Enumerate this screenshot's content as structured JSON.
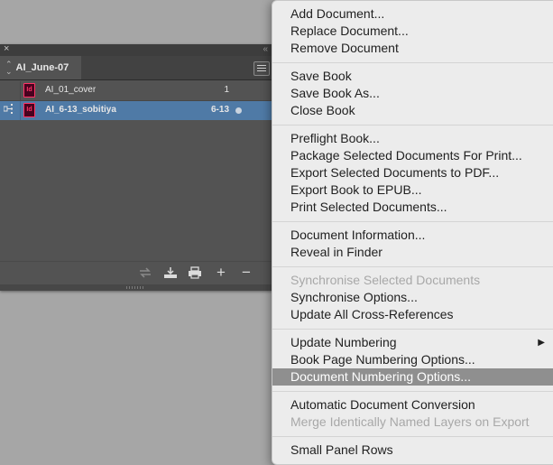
{
  "panel": {
    "tab_label": "AI_June-07",
    "documents": [
      {
        "name": "AI_01_cover",
        "pages": "1",
        "icon_text": "Id"
      },
      {
        "name": "AI_6-13_sobitiya",
        "pages": "6-13",
        "icon_text": "Id"
      }
    ],
    "footer_icons": [
      "sync-styles-icon",
      "add-document-icon",
      "print-icon",
      "plus-icon",
      "minus-icon"
    ],
    "glyphs": {
      "close": "×",
      "collapse": "«",
      "up": "⌃",
      "down": "⌄",
      "plus": "+",
      "minus": "−"
    }
  },
  "menu": {
    "groups": [
      [
        "Add Document...",
        "Replace Document...",
        "Remove Document"
      ],
      [
        "Save Book",
        "Save Book As...",
        "Close Book"
      ],
      [
        "Preflight Book...",
        "Package Selected Documents For Print...",
        "Export Selected Documents to PDF...",
        "Export Book to EPUB...",
        "Print Selected Documents..."
      ],
      [
        "Document Information...",
        "Reveal in Finder"
      ],
      [
        "Synchronise Selected Documents",
        "Synchronise Options...",
        "Update All Cross-References"
      ],
      [
        "Update Numbering",
        "Book Page Numbering Options...",
        "Document Numbering Options..."
      ],
      [
        "Automatic Document Conversion",
        "Merge Identically Named Layers on Export"
      ],
      [
        "Small Panel Rows"
      ]
    ],
    "disabled_items": [
      "Synchronise Selected Documents",
      "Merge Identically Named Layers on Export"
    ],
    "highlighted_item": "Document Numbering Options...",
    "submenu_items": [
      "Update Numbering"
    ],
    "submenu_arrow": "▶"
  },
  "colors": {
    "selection_row": "#4f7aa6",
    "menu_highlight": "#8f8f8f",
    "indesign_icon": "#ff3366"
  }
}
